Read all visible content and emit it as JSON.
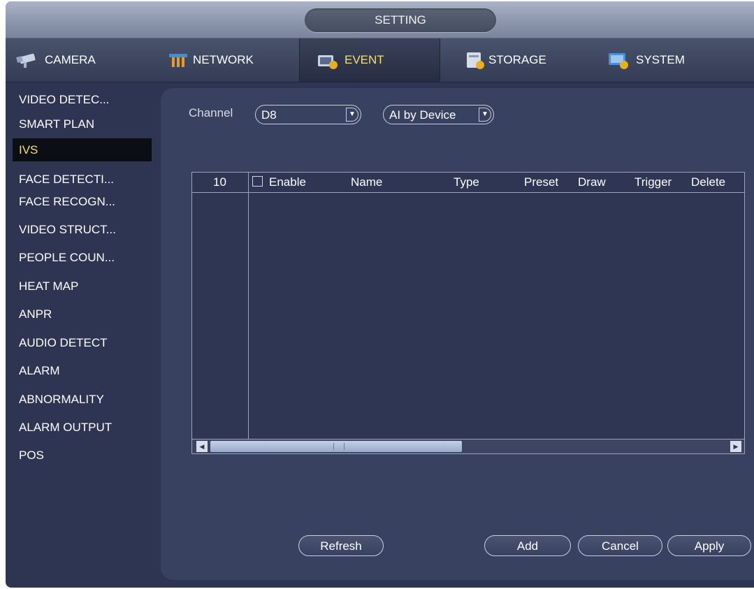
{
  "title": "SETTING",
  "tabs": [
    {
      "label": "CAMERA",
      "icon": "camera-icon"
    },
    {
      "label": "NETWORK",
      "icon": "network-icon"
    },
    {
      "label": "EVENT",
      "icon": "event-icon",
      "active": true
    },
    {
      "label": "STORAGE",
      "icon": "storage-icon"
    },
    {
      "label": "SYSTEM",
      "icon": "system-icon"
    }
  ],
  "sidebar": {
    "items": [
      {
        "label": "VIDEO DETEC..."
      },
      {
        "label": "SMART PLAN"
      },
      {
        "label": "IVS",
        "active": true
      },
      {
        "label": "FACE DETECTI..."
      },
      {
        "label": "FACE RECOGN..."
      },
      {
        "label": "VIDEO STRUCT..."
      },
      {
        "label": "PEOPLE COUN..."
      },
      {
        "label": "HEAT MAP"
      },
      {
        "label": "ANPR"
      },
      {
        "label": "AUDIO DETECT"
      },
      {
        "label": "ALARM"
      },
      {
        "label": "ABNORMALITY"
      },
      {
        "label": "ALARM OUTPUT"
      },
      {
        "label": "POS"
      }
    ]
  },
  "channel": {
    "label": "Channel",
    "value": "D8",
    "mode": "AI by Device"
  },
  "table": {
    "count": "10",
    "headers": {
      "enable": "Enable",
      "name": "Name",
      "type": "Type",
      "preset": "Preset",
      "draw": "Draw",
      "trigger": "Trigger",
      "delete": "Delete"
    },
    "rows": []
  },
  "buttons": {
    "refresh": "Refresh",
    "add": "Add",
    "cancel": "Cancel",
    "apply": "Apply"
  },
  "colors": {
    "active_text": "#f5e06a",
    "background": "#2d3552",
    "panel": "#394160"
  }
}
